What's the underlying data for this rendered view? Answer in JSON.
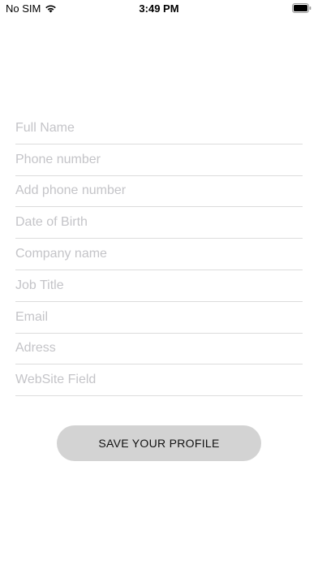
{
  "status_bar": {
    "carrier": "No SIM",
    "time": "3:49 PM",
    "wifi_icon": "wifi-icon",
    "battery_icon": "battery-full-icon"
  },
  "form": {
    "fields": [
      {
        "placeholder": "Full Name",
        "value": ""
      },
      {
        "placeholder": "Phone number",
        "value": ""
      },
      {
        "placeholder": "Add phone number",
        "value": ""
      },
      {
        "placeholder": "Date of Birth",
        "value": ""
      },
      {
        "placeholder": "Company name",
        "value": ""
      },
      {
        "placeholder": "Job Title",
        "value": ""
      },
      {
        "placeholder": "Email",
        "value": ""
      },
      {
        "placeholder": "Adress",
        "value": ""
      },
      {
        "placeholder": "WebSite Field",
        "value": ""
      }
    ]
  },
  "actions": {
    "save_label": "SAVE YOUR PROFILE"
  },
  "colors": {
    "button_background": "#d3d3d3",
    "placeholder_text": "#c4c4c8",
    "divider": "#dcdcdc"
  }
}
